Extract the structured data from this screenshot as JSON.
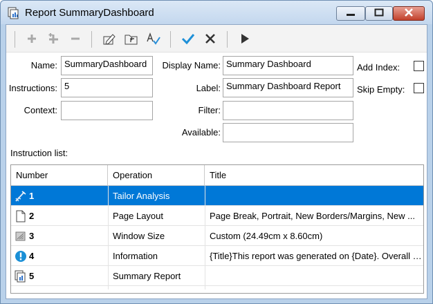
{
  "window": {
    "title": "Report SummaryDashboard"
  },
  "toolbar": {
    "icons": [
      "add-icon",
      "add-multiple-icon",
      "remove-icon",
      "edit-icon",
      "move-to-parent-icon",
      "spellcheck-icon",
      "check-icon",
      "cancel-icon",
      "run-icon"
    ]
  },
  "form": {
    "name_label": "Name:",
    "name_value": "SummaryDashboard",
    "instructions_label": "Instructions:",
    "instructions_value": "5",
    "context_label": "Context:",
    "context_value": "",
    "display_name_label": "Display Name:",
    "display_name_value": "Summary Dashboard",
    "label_label": "Label:",
    "label_value": "Summary Dashboard Report",
    "filter_label": "Filter:",
    "filter_value": "",
    "available_label": "Available:",
    "available_value": "",
    "add_index_label": "Add Index:",
    "skip_empty_label": "Skip Empty:"
  },
  "instruction_list": {
    "label": "Instruction list:",
    "columns": {
      "number": "Number",
      "operation": "Operation",
      "title": "Title"
    },
    "rows": [
      {
        "number": "1",
        "operation": "Tailor Analysis",
        "title": "",
        "icon": "tailor-analysis-icon",
        "selected": true
      },
      {
        "number": "2",
        "operation": "Page Layout",
        "title": "Page Break, Portrait, New Borders/Margins, New ...",
        "icon": "page-icon",
        "selected": false
      },
      {
        "number": "3",
        "operation": "Window Size",
        "title": "Custom (24.49cm x 8.60cm)",
        "icon": "window-size-icon",
        "selected": false
      },
      {
        "number": "4",
        "operation": "Information",
        "title": "{Title}This report was generated on {Date}. Overall {...",
        "icon": "information-icon",
        "selected": false
      },
      {
        "number": "5",
        "operation": "Summary Report",
        "title": "",
        "icon": "summary-report-icon",
        "selected": false
      }
    ]
  },
  "colors": {
    "selection": "#0078d7",
    "accent_check": "#1e90d8",
    "info": "#1a8fd6"
  }
}
